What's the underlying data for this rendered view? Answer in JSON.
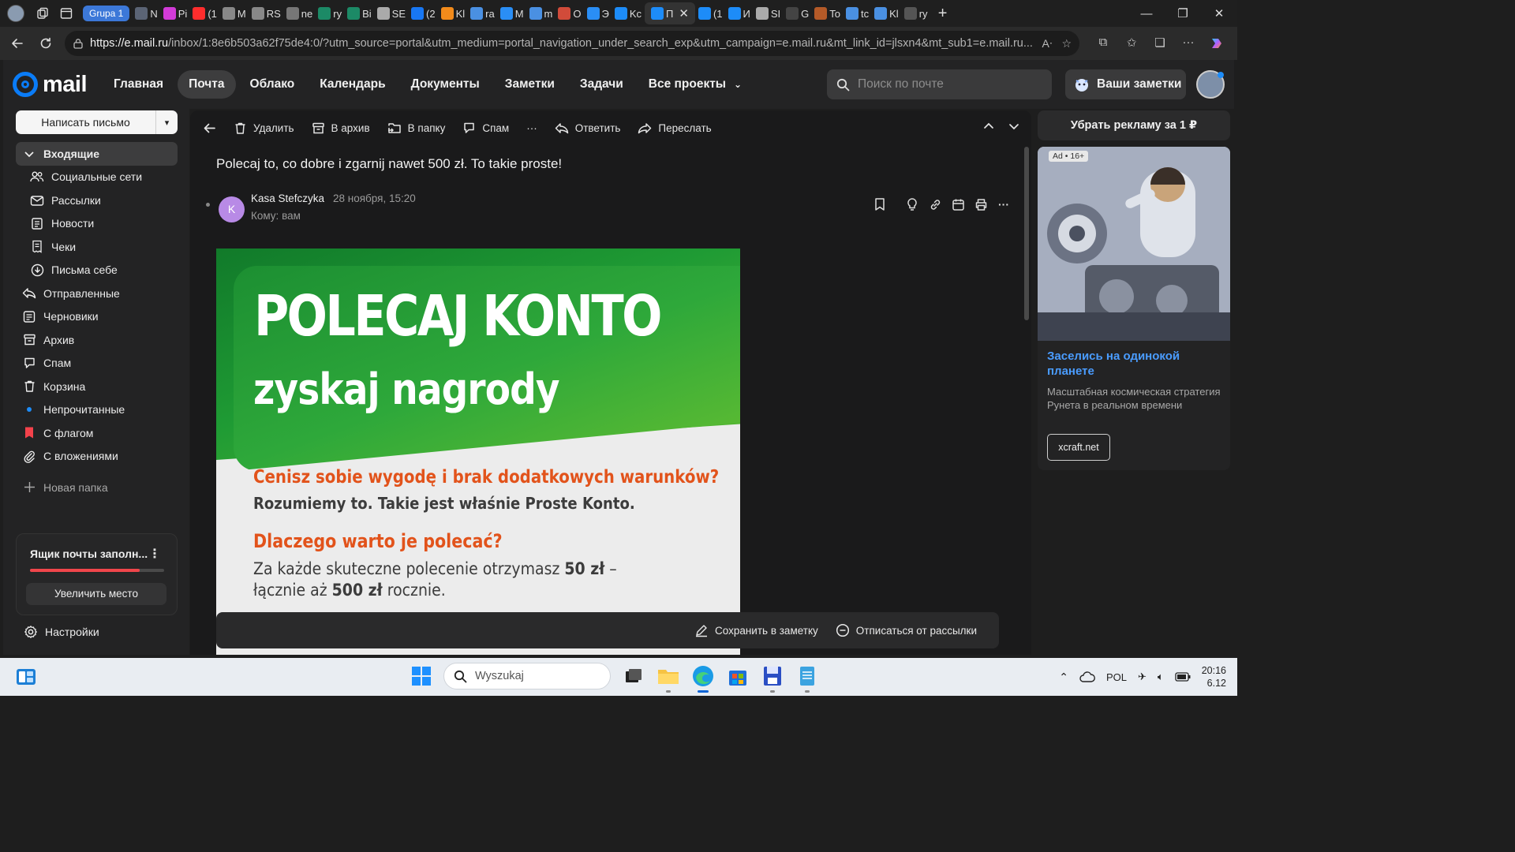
{
  "browser": {
    "tab_group": "Grupa 1",
    "tabs": [
      {
        "label": "N",
        "color": "#5b6475"
      },
      {
        "label": "Pi",
        "color": "#d23bd8"
      },
      {
        "label": "(1",
        "color": "#ff2d2d"
      },
      {
        "label": "M",
        "color": "#888888"
      },
      {
        "label": "RS",
        "color": "#888888"
      },
      {
        "label": "ne",
        "color": "#777777"
      },
      {
        "label": "ry",
        "color": "#1c8a66"
      },
      {
        "label": "Bi",
        "color": "#1c8a66"
      },
      {
        "label": "SE",
        "color": "#aaaaaa"
      },
      {
        "label": "(2",
        "color": "#1877f2"
      },
      {
        "label": "Kl",
        "color": "#f28b1b"
      },
      {
        "label": "ra",
        "color": "#4a90e2"
      },
      {
        "label": "M",
        "color": "#2a8ef5"
      },
      {
        "label": "m",
        "color": "#4a90e2"
      },
      {
        "label": "O",
        "color": "#d14b3a"
      },
      {
        "label": "Э",
        "color": "#2a8ef5"
      },
      {
        "label": "Kc",
        "color": "#1d8cf8"
      }
    ],
    "active_tab": {
      "label": "П",
      "close": "✕"
    },
    "tabs_after": [
      {
        "label": "(1",
        "color": "#1d8cf8"
      },
      {
        "label": "И",
        "color": "#1d8cf8"
      },
      {
        "label": "SI",
        "color": "#aaaaaa"
      },
      {
        "label": "G",
        "color": "#444444"
      },
      {
        "label": "To",
        "color": "#b45a28"
      },
      {
        "label": "tc",
        "color": "#4a90e2"
      },
      {
        "label": "Kl",
        "color": "#4a90e2"
      },
      {
        "label": "ry",
        "color": "#555555"
      }
    ],
    "new_tab": "+",
    "window_controls": [
      "—",
      "❐",
      "✕"
    ],
    "url_host": "https://e.mail.ru",
    "url_rest": "/inbox/1:8e6b503a62f75de4:0/?utm_source=portal&utm_medium=portal_navigation_under_search_exp&utm_campaign=e.mail.ru&mt_link_id=jlsxn4&mt_sub1=e.mail.ru..."
  },
  "mail": {
    "logo_text": "mail",
    "nav": [
      "Главная",
      "Почта",
      "Облако",
      "Календарь",
      "Документы",
      "Заметки",
      "Задачи",
      "Все проекты"
    ],
    "search_placeholder": "Поиск по почте",
    "notes_button": "Ваши заметки",
    "compose": "Написать письмо",
    "folders": [
      {
        "label": "Входящие",
        "icon": "chevron-down-icon",
        "active": true,
        "sub": false
      },
      {
        "label": "Социальные сети",
        "icon": "people-icon",
        "active": false,
        "sub": true
      },
      {
        "label": "Рассылки",
        "icon": "newsletter-icon",
        "active": false,
        "sub": true
      },
      {
        "label": "Новости",
        "icon": "news-icon",
        "active": false,
        "sub": true
      },
      {
        "label": "Чеки",
        "icon": "receipt-icon",
        "active": false,
        "sub": true
      },
      {
        "label": "Письма себе",
        "icon": "self-mail-icon",
        "active": false,
        "sub": true
      },
      {
        "label": "Отправленные",
        "icon": "sent-icon",
        "active": false,
        "sub": false
      },
      {
        "label": "Черновики",
        "icon": "drafts-icon",
        "active": false,
        "sub": false
      },
      {
        "label": "Архив",
        "icon": "archive-icon",
        "active": false,
        "sub": false
      },
      {
        "label": "Спам",
        "icon": "spam-icon",
        "active": false,
        "sub": false
      },
      {
        "label": "Корзина",
        "icon": "trash-icon",
        "active": false,
        "sub": false
      },
      {
        "label": "Непрочитанные",
        "icon": "unread-dot-icon",
        "active": false,
        "sub": false
      },
      {
        "label": "С флагом",
        "icon": "flag-icon",
        "active": false,
        "sub": false
      },
      {
        "label": "С вложениями",
        "icon": "paperclip-icon",
        "active": false,
        "sub": false
      }
    ],
    "new_folder": "Новая папка",
    "storage": {
      "title": "Ящик почты заполн...",
      "fill": 0.82,
      "button": "Увеличить место"
    },
    "settings": "Настройки"
  },
  "message": {
    "toolbar": {
      "delete": "Удалить",
      "archive": "В архив",
      "move": "В папку",
      "spam": "Спам",
      "more": "···",
      "reply": "Ответить",
      "forward": "Переслать"
    },
    "subject": "Polecaj to, co dobre i zgarnij nawet 500 zł. To takie proste!",
    "sender_initial": "K",
    "sender_name": "Kasa Stefczyka",
    "date": "28 ноября, 15:20",
    "to_label": "Кому:",
    "to_value": "вам",
    "banner": {
      "headline1": "POLECAJ KONTO",
      "headline2": "zyskaj nagrody",
      "line1": "Cenisz sobie wygodę i brak dodatkowych warunków?",
      "line2": "Rozumiemy to. Takie jest właśnie Proste Konto.",
      "line3": "Dlaczego warto je polecać?",
      "line4a": "Za każde skuteczne polecenie otrzymasz ",
      "line4b": "50 zł",
      "line4c": " –",
      "line5a": "łącznie aż ",
      "line5b": "500 zł",
      "line5c": " rocznie."
    },
    "footer": {
      "save_note": "Сохранить в заметку",
      "unsubscribe": "Отписаться от рассылки"
    }
  },
  "ad": {
    "top": "Убрать рекламу за 1 ₽",
    "badge": "Ad • 16+",
    "title": "Заселись на одинокой планете",
    "description": "Масштабная космическая стратегия Рунета в реальном времени",
    "button": "xcraft.net"
  },
  "taskbar": {
    "search": "Wyszukaj",
    "lang": "POL",
    "time": "20:16",
    "date": "6.12"
  }
}
